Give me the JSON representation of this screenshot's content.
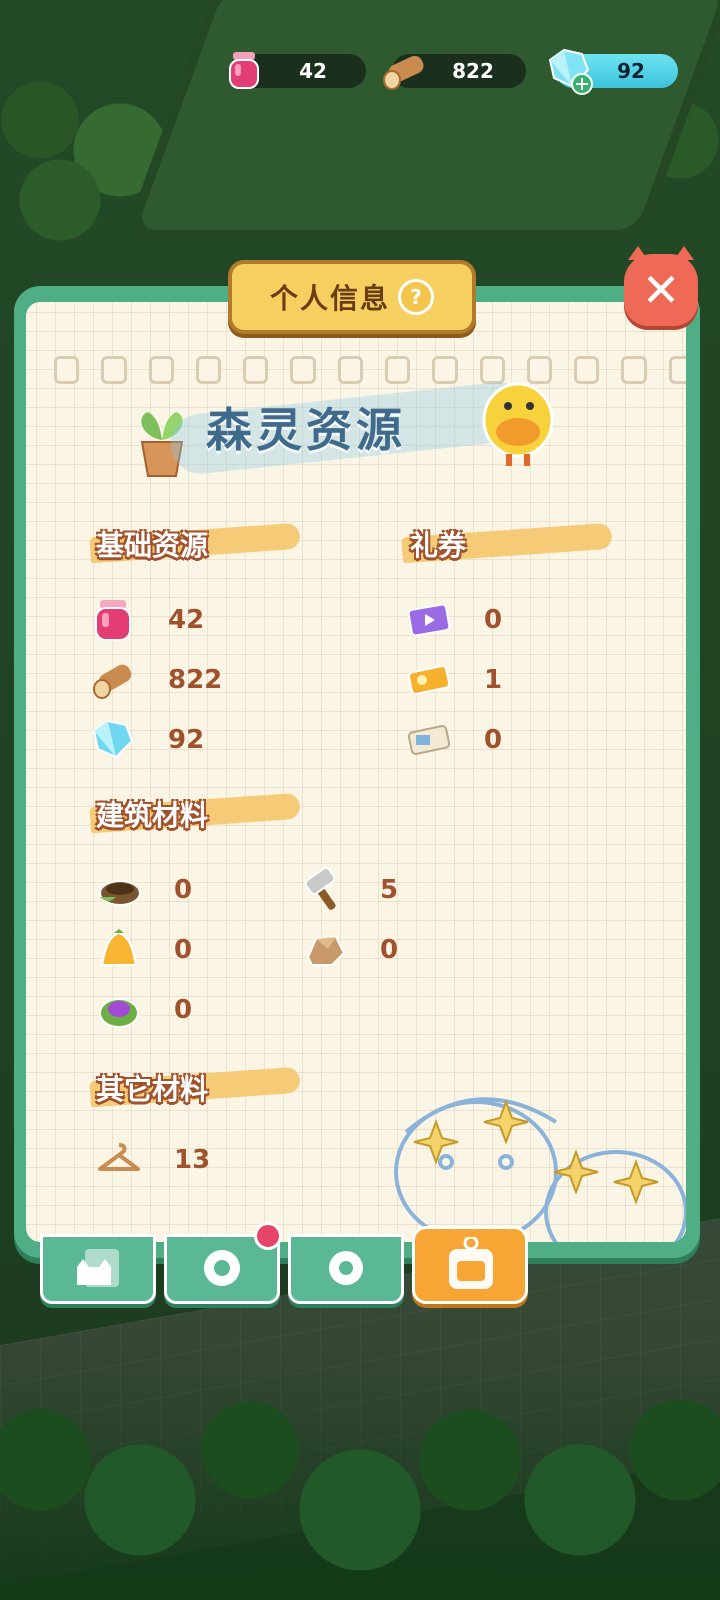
{
  "top_bar": {
    "jam": {
      "icon": "jam-jar-icon",
      "value": "42"
    },
    "wood": {
      "icon": "wood-log-icon",
      "value": "822"
    },
    "gem": {
      "icon": "diamond-icon",
      "value": "92"
    }
  },
  "dialog": {
    "title": "个人信息",
    "help_label": "?",
    "close_label": "✕",
    "headline": "森灵资源",
    "sections": {
      "basic": {
        "title": "基础资源",
        "items": [
          {
            "icon": "jam-jar-icon",
            "value": "42"
          },
          {
            "icon": "wood-log-icon",
            "value": "822"
          },
          {
            "icon": "diamond-icon",
            "value": "92"
          }
        ]
      },
      "coupons": {
        "title": "礼券",
        "items": [
          {
            "icon": "video-ticket-icon",
            "value": "0"
          },
          {
            "icon": "gold-ticket-icon",
            "value": "1"
          },
          {
            "icon": "paper-ticket-icon",
            "value": "0"
          }
        ]
      },
      "building": {
        "title": "建筑材料",
        "items": [
          {
            "icon": "nest-icon",
            "value": "0"
          },
          {
            "icon": "hammer-icon",
            "value": "5"
          },
          {
            "icon": "bell-fruit-icon",
            "value": "0"
          },
          {
            "icon": "stone-block-icon",
            "value": "0"
          },
          {
            "icon": "purple-leaf-icon",
            "value": "0"
          }
        ]
      },
      "other": {
        "title": "其它材料",
        "items": [
          {
            "icon": "hanger-icon",
            "value": "13"
          }
        ]
      }
    },
    "tabs": [
      {
        "icon": "cat-card-icon",
        "active": false
      },
      {
        "icon": "flower-badge-icon",
        "active": false,
        "badge": true
      },
      {
        "icon": "gear-icon",
        "active": false
      },
      {
        "icon": "resource-bag-icon",
        "active": true
      }
    ]
  },
  "colors": {
    "panel_green": "#4fae86",
    "paper": "#fbf5e6",
    "title_tab": "#f6cf61",
    "number_brown": "#a0522d",
    "active_tab": "#f7a534",
    "close_red": "#ee6a56"
  }
}
